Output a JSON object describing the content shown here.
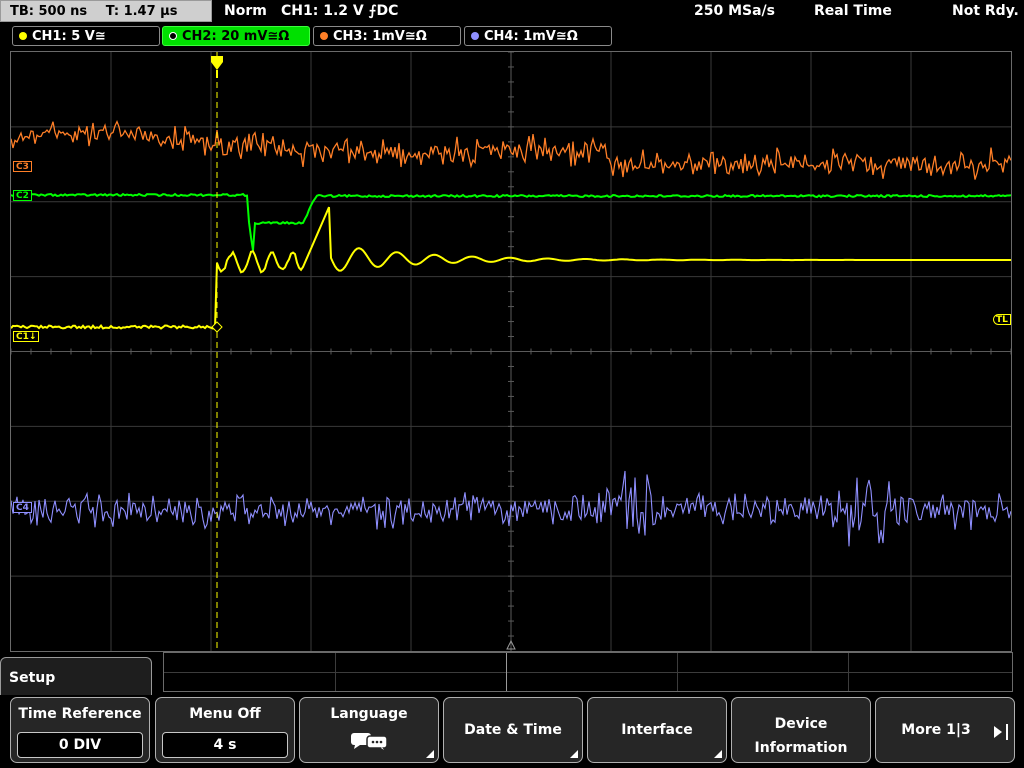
{
  "status": {
    "timebase": "TB: 500 ns",
    "trigger_time": "T: 1.47 µs",
    "mode": "Norm",
    "trigger_setting": "CH1: 1.2 V ⨍DC",
    "sample_rate": "250 MSa/s",
    "acq_mode": "Real Time",
    "state": "Not Rdy."
  },
  "channels": [
    {
      "label": "CH1: 5 V≅",
      "color": "#ffff00",
      "active": false
    },
    {
      "label": "CH2: 20 mV≅Ω",
      "color": "#00ff00",
      "active": true
    },
    {
      "label": "CH3: 1mV≅Ω",
      "color": "#ff7f27",
      "active": false
    },
    {
      "label": "CH4: 1mV≅Ω",
      "color": "#8f8fff",
      "active": false
    }
  ],
  "markers": {
    "ch3": "C3",
    "ch2": "C2",
    "ch1": "C1↓",
    "ch4": "C4",
    "trigger_level": "TL"
  },
  "menu": {
    "title": "Setup",
    "softkeys": [
      {
        "label": "Time Reference",
        "value": "0 DIV"
      },
      {
        "label": "Menu Off",
        "value": "4 s"
      },
      {
        "label": "Language",
        "icon": "speech-bubbles-icon"
      },
      {
        "label": "Date & Time"
      },
      {
        "label": "Interface"
      },
      {
        "label": "Device Information"
      },
      {
        "label": "More 1|3"
      }
    ]
  },
  "colors": {
    "ch1": "#ffff00",
    "ch2": "#00ff00",
    "ch3": "#ff7f27",
    "ch4": "#8f8fff",
    "grid": "#3a3a3a"
  }
}
